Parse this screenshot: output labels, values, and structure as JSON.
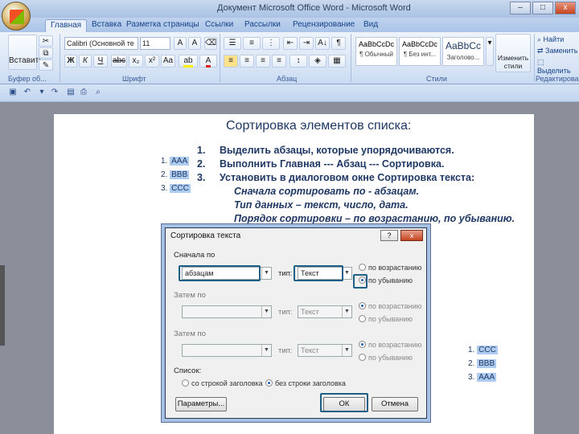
{
  "window": {
    "title": "Документ Microsoft Office Word - Microsoft Word",
    "minimize": "–",
    "maximize": "□",
    "close": "x"
  },
  "ribbon_tabs": [
    "Главная",
    "Вставка",
    "Разметка страницы",
    "Ссылки",
    "Рассылки",
    "Рецензирование",
    "Вид"
  ],
  "ribbon": {
    "paste_label": "Вставить",
    "clipboard_group": "Буфер об...",
    "font_name": "Calibri (Основной те",
    "font_size": "11",
    "font_group": "Шрифт",
    "paragraph_group": "Абзац",
    "styles_group": "Стили",
    "edit_group": "Редактирование",
    "styles": [
      {
        "sample": "AaBbCcDc",
        "name": "¶ Обычный"
      },
      {
        "sample": "AaBbCcDc",
        "name": "¶ Без инт..."
      },
      {
        "sample": "AaBbCc",
        "name": "Заголово..."
      }
    ],
    "change_styles": "Изменить стили",
    "find": "Найти",
    "replace": "Заменить",
    "select": "Выделить"
  },
  "document": {
    "heading": "Сортировка элементов списка:",
    "list_original": [
      {
        "num": "1.",
        "text": "ААА"
      },
      {
        "num": "2.",
        "text": "ВВВ"
      },
      {
        "num": "3.",
        "text": "ССС"
      }
    ],
    "steps": [
      {
        "num": "1.",
        "text": "Выделить абзацы, которые упорядочиваются."
      },
      {
        "num": "2.",
        "text": "Выполнить Главная --- Абзац --- Сортировка."
      },
      {
        "num": "3.",
        "text": "Установить в диалоговом окне Сортировка текста:"
      }
    ],
    "substeps": [
      "Сначала сортировать по - абзацам.",
      "Тип данных – текст, число, дата.",
      "Порядок сортировки – по возрастанию, по убыванию."
    ],
    "list_sorted": [
      {
        "num": "1.",
        "text": "ССС"
      },
      {
        "num": "2.",
        "text": "ВВВ"
      },
      {
        "num": "3.",
        "text": "ААА"
      }
    ]
  },
  "dialog": {
    "title": "Сортировка текста",
    "help": "?",
    "close": "x",
    "first_by_label": "Сначала по",
    "first_by_value": "абзацам",
    "type_label": "тип:",
    "type_value": "Текст",
    "then_by_label": "Затем по",
    "then_by2_label": "Затем по",
    "ascending": "по возрастанию",
    "descending": "по убыванию",
    "list_label": "Список:",
    "with_header": "со строкой заголовка",
    "no_header": "без строки заголовка",
    "params_button": "Параметры...",
    "ok_button": "ОК",
    "cancel_button": "Отмена",
    "first_order": "descending",
    "header_mode": "no_header"
  },
  "colors": {
    "highlight": "#aecbf0",
    "doc_text": "#1f3864",
    "callout": "#1f5f86"
  }
}
